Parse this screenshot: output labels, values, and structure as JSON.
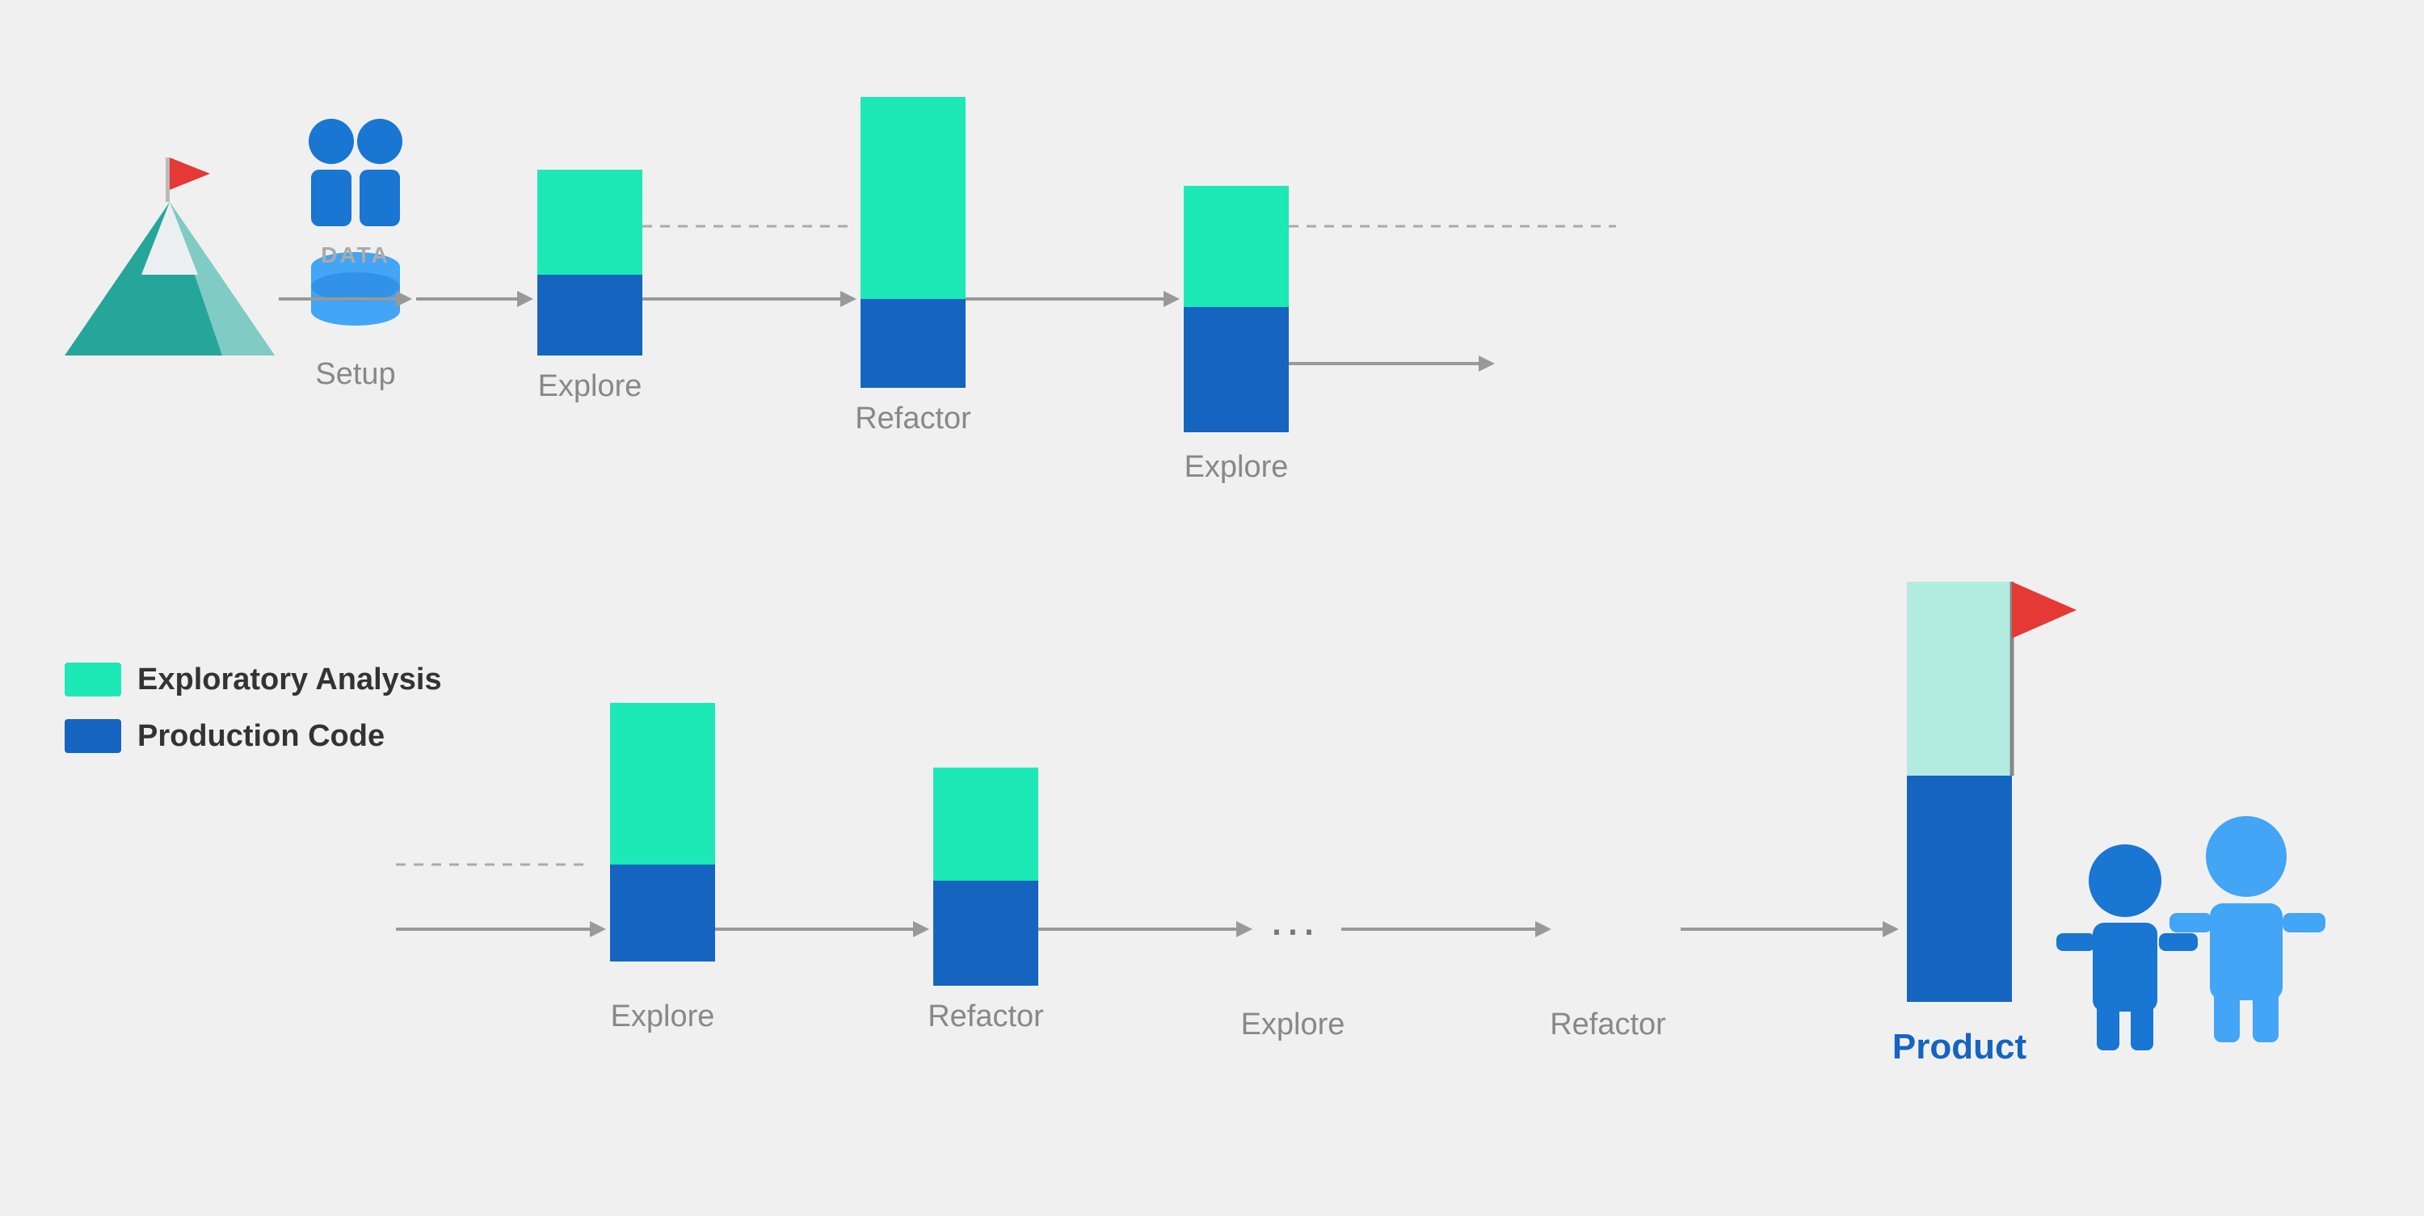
{
  "legend": {
    "exploratory_label": "Exploratory Analysis",
    "production_label": "Production Code",
    "colors": {
      "green": "#1de9b6",
      "blue": "#1565c0",
      "light_teal": "#b2ebe0"
    }
  },
  "top_row": {
    "steps": [
      {
        "id": "setup",
        "label": "Setup",
        "type": "icon"
      },
      {
        "id": "explore1",
        "label": "Explore",
        "green_height": 130,
        "blue_height": 100
      },
      {
        "id": "refactor1",
        "label": "Refactor",
        "green_height": 250,
        "blue_height": 110
      },
      {
        "id": "explore2",
        "label": "Explore",
        "green_height": 150,
        "blue_height": 155
      }
    ],
    "arrows": [
      "solid",
      "dashed",
      "solid",
      "solid"
    ]
  },
  "bottom_row": {
    "steps": [
      {
        "id": "explore3",
        "label": "Explore",
        "green_height": 200,
        "blue_height": 120
      },
      {
        "id": "refactor2",
        "label": "Refactor",
        "green_height": 140,
        "blue_height": 130
      },
      {
        "id": "explore4",
        "label": "Explore",
        "green_height": 0,
        "blue_height": 0,
        "is_dots": true
      },
      {
        "id": "refactor3",
        "label": "Refactor",
        "green_height": 0,
        "blue_height": 0,
        "is_text_only": true
      },
      {
        "id": "product",
        "label": "Product",
        "green_height": 240,
        "blue_height": 280,
        "is_product": true
      }
    ]
  },
  "icons": {
    "mountain_flag_color": "#e53935",
    "mountain_main_color": "#26a69a",
    "mountain_side_color": "#80cbc4",
    "mountain_snow_color": "#eceff1",
    "person_color": "#1976d2",
    "database_color": "#90caf9",
    "flag_color": "#e53935"
  }
}
